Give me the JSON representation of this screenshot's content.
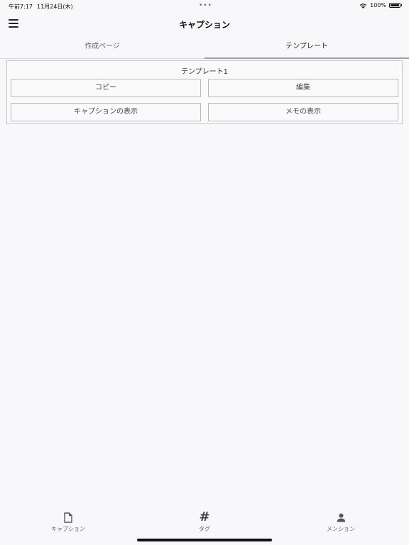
{
  "status_bar": {
    "time": "午前7:17",
    "date": "11月24日(木)",
    "battery": "100%",
    "battery_level": 1.0
  },
  "nav": {
    "title": "キャプション"
  },
  "tabs": [
    {
      "label": "作成ページ",
      "active": false
    },
    {
      "label": "テンプレート",
      "active": true
    }
  ],
  "template": {
    "title": "テンプレート1",
    "copy_label": "コピー",
    "edit_label": "編集",
    "show_caption_label": "キャプションの表示",
    "show_memo_label": "メモの表示"
  },
  "bottom_nav": [
    {
      "label": "キャプション",
      "icon": "document-icon"
    },
    {
      "label": "タグ",
      "icon": "hash-icon"
    },
    {
      "label": "メンション",
      "icon": "person-icon"
    }
  ]
}
